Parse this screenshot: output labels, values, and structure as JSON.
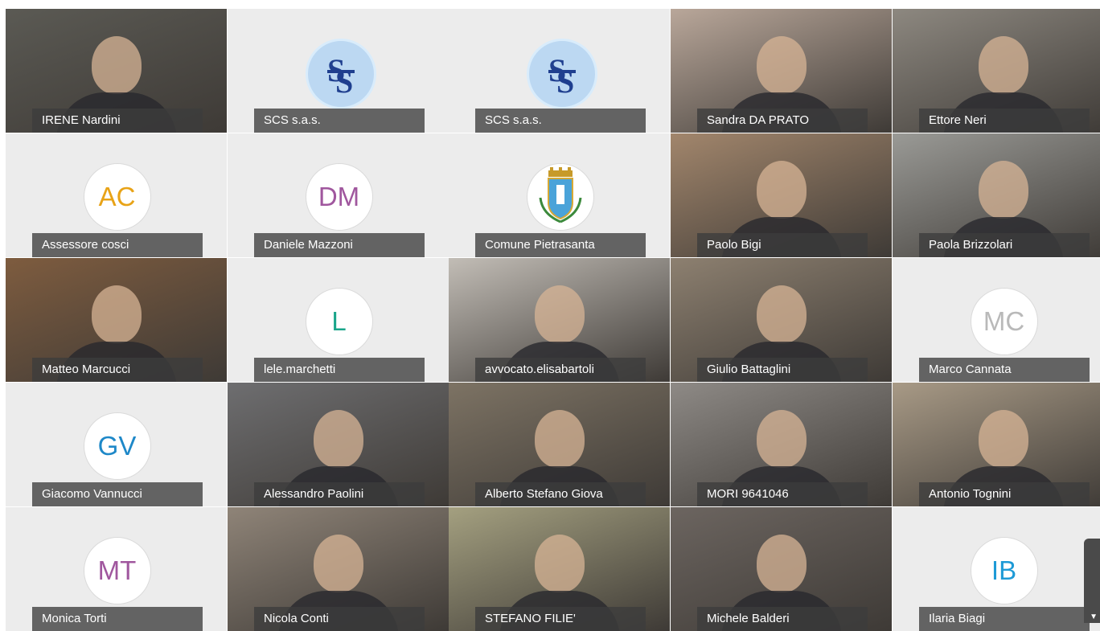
{
  "colors": {
    "nameplate": "#3c3c3c",
    "avatar_bg": "#ffffff",
    "tile_bg": "#ececec"
  },
  "tiles": [
    {
      "name": "IRENE Nardini",
      "type": "video",
      "tone": "#5b5a54"
    },
    {
      "name": "SCS s.a.s.",
      "type": "logo",
      "icon": "scs-logo-icon"
    },
    {
      "name": "SCS s.a.s.",
      "type": "logo",
      "icon": "scs-logo-icon"
    },
    {
      "name": "Sandra DA PRATO",
      "type": "video",
      "tone": "#b9a79a"
    },
    {
      "name": "Ettore Neri",
      "type": "video",
      "tone": "#8d8880"
    },
    {
      "name": "Assessore cosci",
      "type": "initials",
      "initials": "AC",
      "color": "#e8a317"
    },
    {
      "name": "Daniele Mazzoni",
      "type": "initials",
      "initials": "DM",
      "color": "#a0579e"
    },
    {
      "name": "Comune Pietrasanta",
      "type": "crest",
      "icon": "pietrasanta-crest-icon"
    },
    {
      "name": "Paolo Bigi",
      "type": "video",
      "tone": "#a2866c"
    },
    {
      "name": "Paola Brizzolari",
      "type": "video",
      "tone": "#9a9a96"
    },
    {
      "name": "Matteo Marcucci",
      "type": "video",
      "tone": "#7e5c3f"
    },
    {
      "name": "lele.marchetti",
      "type": "initials",
      "initials": "L",
      "color": "#1aa58a"
    },
    {
      "name": "avvocato.elisabartoli",
      "type": "video",
      "tone": "#c2bdb6"
    },
    {
      "name": "Giulio Battaglini",
      "type": "video",
      "tone": "#8d8070"
    },
    {
      "name": "Marco Cannata",
      "type": "initials",
      "initials": "MC",
      "color": "#b9b9b9"
    },
    {
      "name": "Giacomo Vannucci",
      "type": "initials",
      "initials": "GV",
      "color": "#1e88c8"
    },
    {
      "name": "Alessandro Paolini",
      "type": "video",
      "tone": "#6e6e70"
    },
    {
      "name": "Alberto Stefano Giova",
      "type": "video",
      "tone": "#7d7364"
    },
    {
      "name": "MORI 9641046",
      "type": "video",
      "tone": "#8e8a86"
    },
    {
      "name": "Antonio Tognini",
      "type": "video",
      "tone": "#a89a86"
    },
    {
      "name": "Monica Torti",
      "type": "initials",
      "initials": "MT",
      "color": "#a0579e"
    },
    {
      "name": "Nicola Conti",
      "type": "video",
      "tone": "#8f8478"
    },
    {
      "name": "STEFANO FILIE'",
      "type": "video",
      "tone": "#a4a080"
    },
    {
      "name": "Michele Balderi",
      "type": "video",
      "tone": "#6c6560"
    },
    {
      "name": "Ilaria Biagi",
      "type": "initials",
      "initials": "IB",
      "color": "#1e9ad6"
    }
  ]
}
